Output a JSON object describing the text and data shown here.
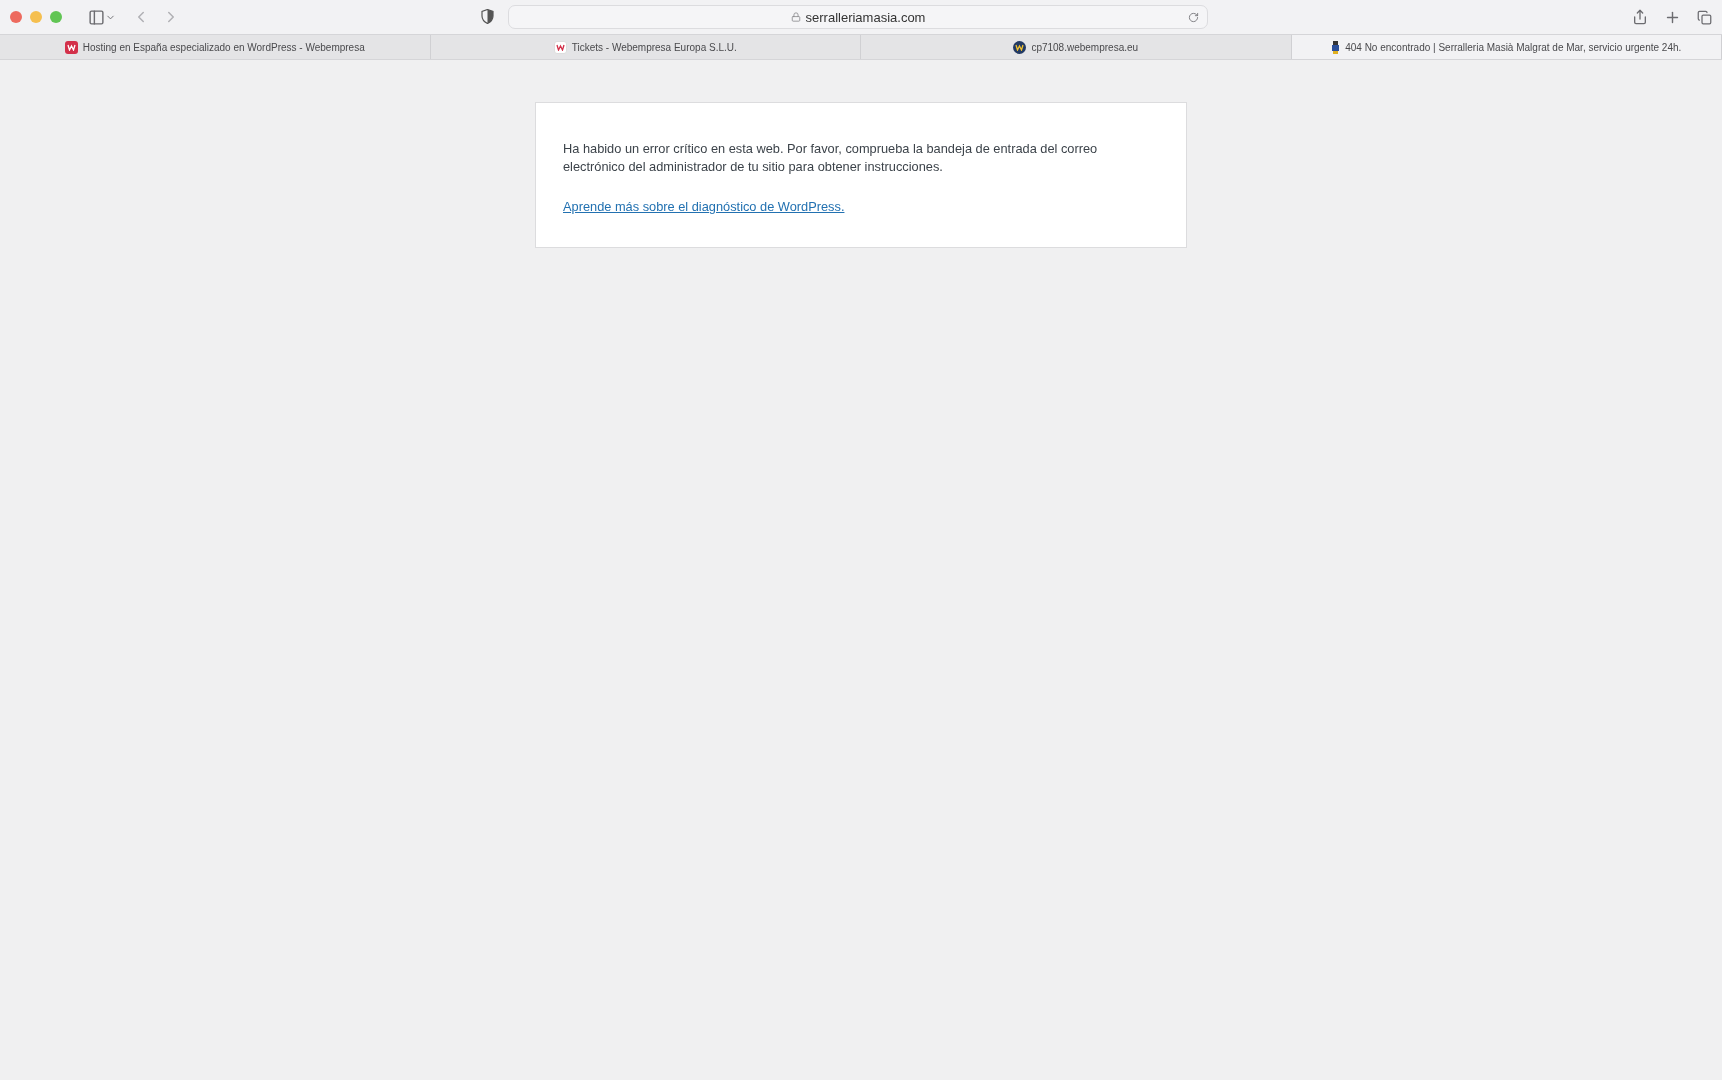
{
  "toolbar": {
    "address": "serralleriamasia.com"
  },
  "tabs": [
    {
      "label": "Hosting en España especializado en WordPress - Webempresa",
      "selected": false,
      "kind": "w-red"
    },
    {
      "label": "Tickets - Webempresa Europa S.L.U.",
      "selected": false,
      "kind": "w-white"
    },
    {
      "label": "cp7108.webempresa.eu",
      "selected": false,
      "kind": "w-navy"
    },
    {
      "label": "404 No encontrado | Serralleria Masià Malgrat de Mar, servicio urgente 24h.",
      "selected": true,
      "kind": "figure"
    }
  ],
  "error_card": {
    "message": "Ha habido un error crítico en esta web. Por favor, comprueba la bandeja de entrada del correo electrónico del administrador de tu sitio para obtener instrucciones.",
    "link": "Aprende más sobre el diagnóstico de WordPress."
  }
}
